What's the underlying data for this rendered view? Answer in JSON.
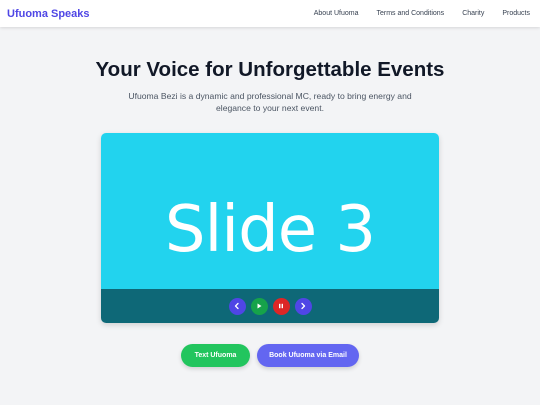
{
  "nav": {
    "brand": "Ufuoma Speaks",
    "links": [
      "About Ufuoma",
      "Terms and Conditions",
      "Charity",
      "Products"
    ]
  },
  "hero": {
    "title": "Your Voice for Unforgettable Events",
    "subtitle": "Ufuoma Bezi is a dynamic and professional MC, ready to bring energy and elegance to your next event."
  },
  "slider": {
    "slide_text": "Slide 3",
    "controls": [
      {
        "name": "previous",
        "icon": "chevron-left-icon",
        "color": "#4f46e5"
      },
      {
        "name": "play",
        "icon": "play-icon",
        "color": "#16a34a"
      },
      {
        "name": "pause",
        "icon": "pause-icon",
        "color": "#dc2626"
      },
      {
        "name": "next",
        "icon": "chevron-right-icon",
        "color": "#4f46e5"
      }
    ]
  },
  "cta": {
    "text_button": "Text Ufuoma",
    "email_button": "Book Ufuoma via Email"
  },
  "colors": {
    "brand": "#4f46e5",
    "slide_bg": "#22d3ee",
    "controls_bar": "#0e6877",
    "text_button": "#22c55e",
    "email_button": "#6366f1"
  }
}
